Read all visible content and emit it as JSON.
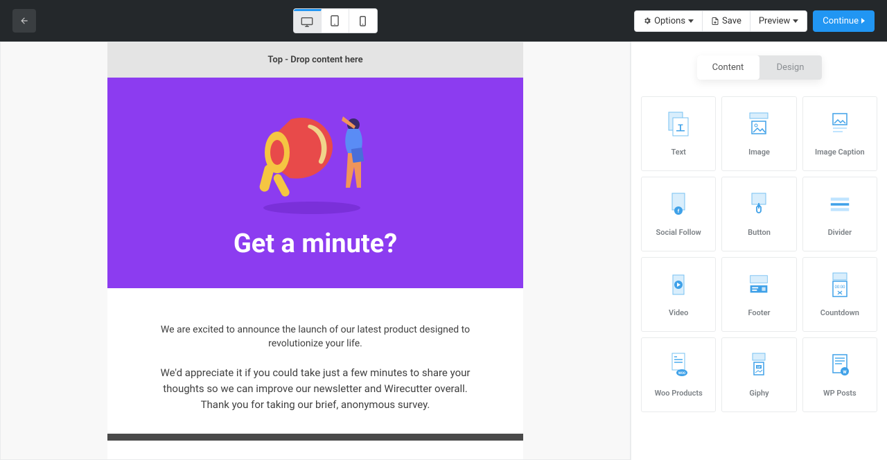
{
  "topbar": {
    "options_label": "Options",
    "save_label": "Save",
    "preview_label": "Preview",
    "continue_label": "Continue"
  },
  "canvas": {
    "dropzone_label": "Top - Drop content here",
    "hero_title": "Get a minute?",
    "paragraph_1": "We are excited to announce the launch of our latest product designed to revolutionize your life.",
    "paragraph_2": "We'd appreciate it if you could take just a few minutes to share your thoughts so we can improve our newsletter and Wirecutter overall. Thank you for taking our brief, anonymous survey."
  },
  "sidebar": {
    "tabs": {
      "content": "Content",
      "design": "Design"
    },
    "blocks": [
      {
        "label": "Text"
      },
      {
        "label": "Image"
      },
      {
        "label": "Image Caption"
      },
      {
        "label": "Social Follow"
      },
      {
        "label": "Button"
      },
      {
        "label": "Divider"
      },
      {
        "label": "Video"
      },
      {
        "label": "Footer"
      },
      {
        "label": "Countdown"
      },
      {
        "label": "Woo Products"
      },
      {
        "label": "Giphy"
      },
      {
        "label": "WP Posts"
      }
    ]
  },
  "colors": {
    "accent": "#2196f3",
    "hero_bg": "#8c3cf0",
    "icon_fill": "#bfe4ff",
    "icon_stroke": "#5ab6f5"
  }
}
